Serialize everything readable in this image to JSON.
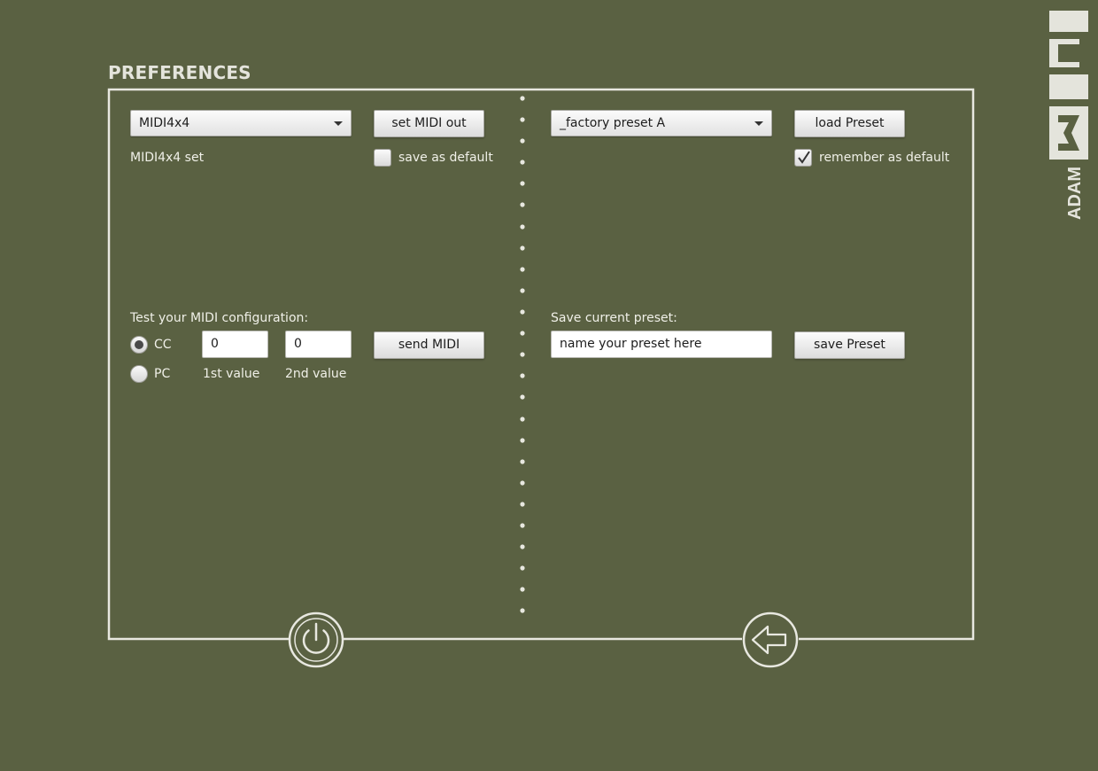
{
  "header": {
    "title": "PREFERENCES"
  },
  "brand": {
    "company": "ADAM",
    "product": "MIDI"
  },
  "midi_out": {
    "device_select": "MIDI4x4",
    "set_button": "set MIDI out",
    "status": "MIDI4x4 set",
    "save_default_label": "save as default",
    "save_default_checked": false
  },
  "test": {
    "heading": "Test your MIDI configuration:",
    "mode_options": [
      {
        "label": "CC",
        "selected": true
      },
      {
        "label": "PC",
        "selected": false
      }
    ],
    "value1": "0",
    "value2": "0",
    "value1_label": "1st value",
    "value2_label": "2nd value",
    "send_button": "send MIDI"
  },
  "preset": {
    "selected": "_factory preset A",
    "load_button": "load Preset",
    "remember_label": "remember as default",
    "remember_checked": true,
    "save_heading": "Save current preset:",
    "name_placeholder": "name your preset here",
    "save_button": "save Preset"
  },
  "footer": {
    "power_icon": "power-icon",
    "back_icon": "back-arrow-icon"
  },
  "colors": {
    "background": "#5a6142",
    "frame": "#e8e8e0"
  }
}
